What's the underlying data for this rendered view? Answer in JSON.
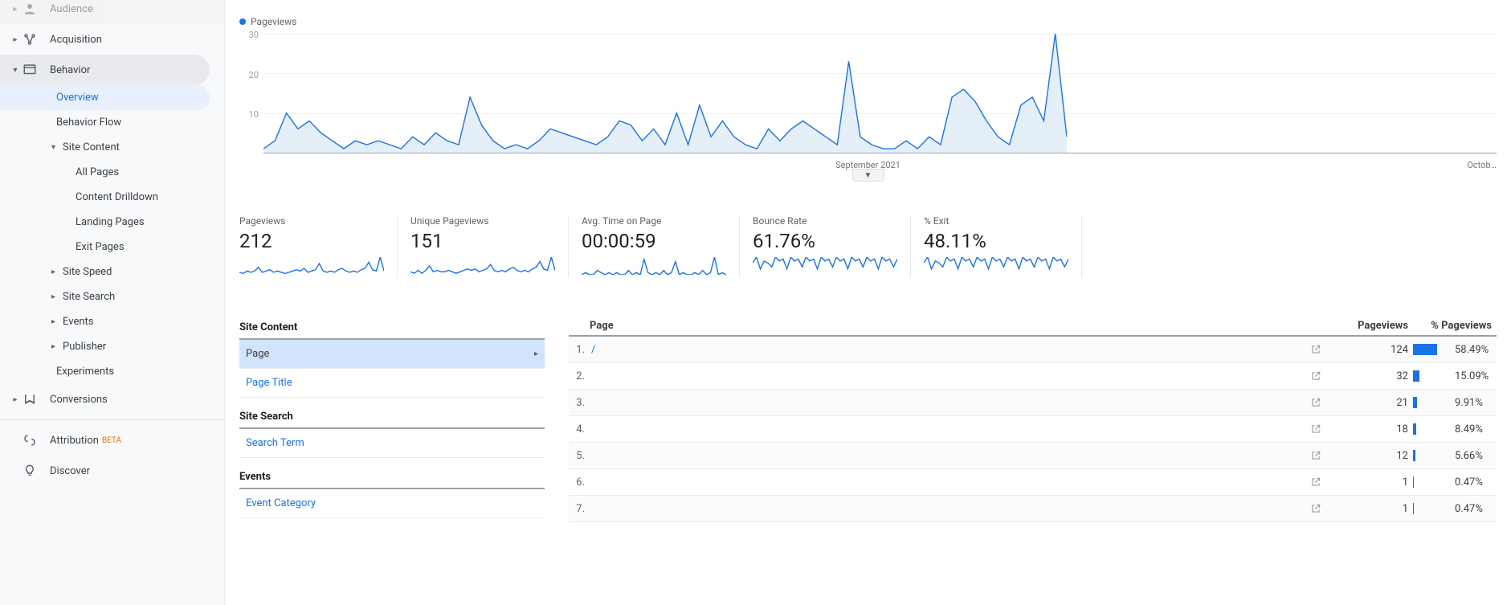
{
  "sidebar": {
    "audience": "Audience",
    "acquisition": "Acquisition",
    "behavior": "Behavior",
    "overview": "Overview",
    "behavior_flow": "Behavior Flow",
    "site_content": "Site Content",
    "all_pages": "All Pages",
    "content_drilldown": "Content Drilldown",
    "landing_pages": "Landing Pages",
    "exit_pages": "Exit Pages",
    "site_speed": "Site Speed",
    "site_search": "Site Search",
    "events": "Events",
    "publisher": "Publisher",
    "experiments": "Experiments",
    "conversions": "Conversions",
    "attribution": "Attribution",
    "beta_tag": "BETA",
    "discover": "Discover"
  },
  "chart_data": {
    "type": "line",
    "legend": "Pageviews",
    "ylim": [
      0,
      30
    ],
    "yticks": [
      10,
      20,
      30
    ],
    "x_label_middle": "September 2021",
    "x_label_end": "Octob…",
    "values": [
      1,
      3,
      10,
      6,
      8,
      5,
      3,
      1,
      3,
      2,
      3,
      2,
      1,
      4,
      2,
      5,
      3,
      2,
      14,
      7,
      3,
      1,
      2,
      1,
      3,
      6,
      5,
      4,
      3,
      2,
      4,
      8,
      7,
      3,
      6,
      2,
      10,
      2,
      12,
      4,
      8,
      4,
      2,
      1,
      6,
      3,
      6,
      8,
      6,
      4,
      2,
      23,
      4,
      2,
      1,
      1,
      3,
      1,
      4,
      2,
      14,
      16,
      13,
      8,
      4,
      2,
      12,
      14,
      8,
      30,
      4
    ]
  },
  "metrics": [
    {
      "label": "Pageviews",
      "value": "212",
      "spark": [
        2,
        1,
        3,
        2,
        3,
        6,
        2,
        3,
        4,
        2,
        3,
        2,
        1,
        2,
        3,
        4,
        3,
        5,
        2,
        3,
        4,
        9,
        3,
        2,
        3,
        2,
        4,
        5,
        3,
        2,
        3,
        2,
        4,
        5,
        10,
        4,
        3,
        14,
        3
      ]
    },
    {
      "label": "Unique Pageviews",
      "value": "151",
      "spark": [
        2,
        1,
        3,
        1,
        3,
        6,
        2,
        3,
        2,
        2,
        3,
        2,
        1,
        2,
        3,
        4,
        3,
        4,
        2,
        3,
        4,
        7,
        3,
        2,
        3,
        2,
        4,
        5,
        3,
        2,
        3,
        2,
        4,
        5,
        9,
        4,
        3,
        12,
        3
      ]
    },
    {
      "label": "Avg. Time on Page",
      "value": "00:00:59",
      "spark": [
        0,
        1,
        0,
        0,
        2,
        1,
        0,
        1,
        0,
        1,
        0,
        0,
        2,
        0,
        1,
        0,
        7,
        1,
        0,
        1,
        0,
        2,
        0,
        1,
        6,
        0,
        1,
        0,
        0,
        1,
        0,
        2,
        0,
        1,
        8,
        0,
        1,
        0
      ]
    },
    {
      "label": "Bounce Rate",
      "value": "61.76%",
      "spark": [
        6,
        9,
        3,
        7,
        6,
        4,
        9,
        7,
        8,
        3,
        9,
        7,
        8,
        4,
        9,
        7,
        8,
        3,
        9,
        7,
        8,
        4,
        9,
        7,
        8,
        3,
        9,
        7,
        8,
        4,
        9,
        7,
        8,
        3,
        9,
        7,
        8,
        4,
        8
      ]
    },
    {
      "label": "% Exit",
      "value": "48.11%",
      "spark": [
        6,
        9,
        3,
        7,
        6,
        4,
        9,
        7,
        8,
        3,
        9,
        7,
        8,
        4,
        9,
        7,
        8,
        3,
        9,
        7,
        8,
        4,
        9,
        7,
        8,
        3,
        9,
        7,
        8,
        4,
        9,
        7,
        8,
        3,
        9,
        7,
        8,
        4,
        8
      ]
    }
  ],
  "content_panel": {
    "headings": {
      "site_content": "Site Content",
      "site_search": "Site Search",
      "events": "Events"
    },
    "page": "Page",
    "page_title": "Page Title",
    "search_term": "Search Term",
    "event_category": "Event Category"
  },
  "table": {
    "headers": {
      "page": "Page",
      "pageviews": "Pageviews",
      "pct_pageviews": "% Pageviews"
    },
    "rows": [
      {
        "index": "1.",
        "path": "/",
        "pageviews": "124",
        "pct": "58.49%",
        "pct_val": 58.49
      },
      {
        "index": "2.",
        "path": "",
        "pageviews": "32",
        "pct": "15.09%",
        "pct_val": 15.09
      },
      {
        "index": "3.",
        "path": "",
        "pageviews": "21",
        "pct": "9.91%",
        "pct_val": 9.91
      },
      {
        "index": "4.",
        "path": "",
        "pageviews": "18",
        "pct": "8.49%",
        "pct_val": 8.49
      },
      {
        "index": "5.",
        "path": "",
        "pageviews": "12",
        "pct": "5.66%",
        "pct_val": 5.66
      },
      {
        "index": "6.",
        "path": "",
        "pageviews": "1",
        "pct": "0.47%",
        "pct_val": 0.47
      },
      {
        "index": "7.",
        "path": "",
        "pageviews": "1",
        "pct": "0.47%",
        "pct_val": 0.47
      }
    ]
  }
}
